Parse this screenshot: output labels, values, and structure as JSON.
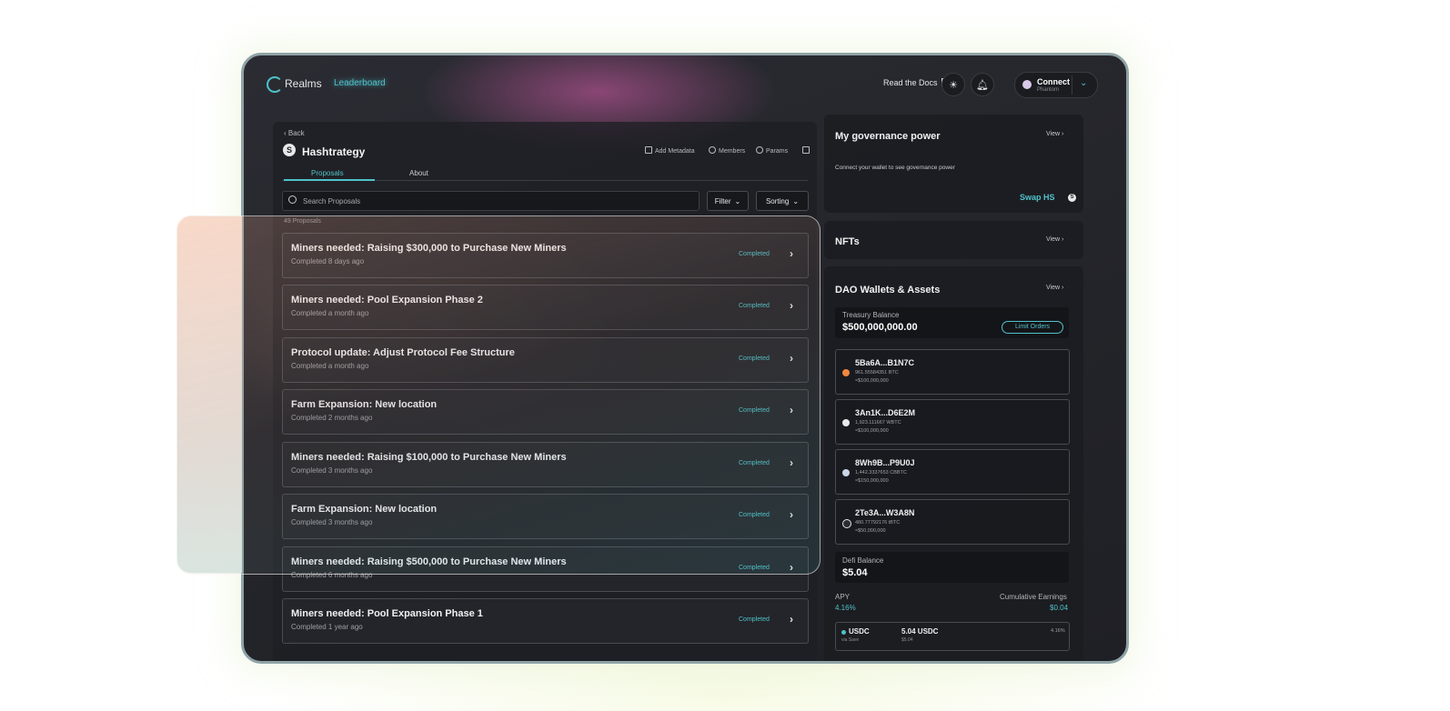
{
  "topbar": {
    "logo_text": "Realms",
    "leaderboard": "Leaderboard",
    "docs": "Read the Docs",
    "connect": {
      "title": "Connect",
      "subtitle": "Phantom"
    }
  },
  "dao": {
    "back": "Back",
    "name": "Hashtrategy",
    "logo_letter": "S",
    "links": [
      "Add Metadata",
      "Members",
      "Params"
    ],
    "tabs": [
      "Proposals",
      "About"
    ],
    "search_placeholder": "Search Proposals",
    "filter": "Filter",
    "sorting": "Sorting",
    "count": "49 Proposals"
  },
  "proposals": [
    {
      "title": "Miners needed: Raising $300,000 to Purchase New Miners",
      "sub": "Completed 8 days ago",
      "status": "Completed"
    },
    {
      "title": "Miners needed: Pool Expansion Phase 2",
      "sub": "Completed a month ago",
      "status": "Completed"
    },
    {
      "title": "Protocol update: Adjust Protocol Fee Structure",
      "sub": "Completed a month ago",
      "status": "Completed"
    },
    {
      "title": "Farm Expansion: New location",
      "sub": "Completed 2 months ago",
      "status": "Completed"
    },
    {
      "title": "Miners needed: Raising $100,000 to Purchase New Miners",
      "sub": "Completed 3 months ago",
      "status": "Completed"
    },
    {
      "title": "Farm Expansion: New location",
      "sub": "Completed 3 months ago",
      "status": "Completed"
    },
    {
      "title": "Miners needed: Raising $500,000 to Purchase New Miners",
      "sub": "Completed 6 months ago",
      "status": "Completed"
    },
    {
      "title": "Miners needed: Pool Expansion Phase 1",
      "sub": "Completed 1 year ago",
      "status": "Completed"
    }
  ],
  "governance": {
    "title": "My governance power",
    "view": "View",
    "text": "Connect your wallet to see governance power",
    "swap": "Swap HS"
  },
  "nfts": {
    "title": "NFTs",
    "view": "View"
  },
  "wallets": {
    "title": "DAO Wallets & Assets",
    "view": "View",
    "treasury_label": "Treasury Balance",
    "treasury_value": "$500,000,000.00",
    "limit_orders": "Limit Orders",
    "items": [
      {
        "addr": "5Ba6A...B1N7C",
        "bal": "961.55584351 BTC",
        "usd": "≈$100,000,000",
        "color": "#f0883e"
      },
      {
        "addr": "3An1K...D6E2M",
        "bal": "1,923.111667 WBTC",
        "usd": "≈$100,000,000",
        "color": "#e8e8ea"
      },
      {
        "addr": "8Wh9B...P9U0J",
        "bal": "1,442.3337653 CBBTC",
        "usd": "≈$150,000,000",
        "color": "#c9d6e8"
      },
      {
        "addr": "2Te3A...W3A8N",
        "bal": "480.77792176 tBTC",
        "usd": "≈$50,000,000",
        "color": "#2b2c33"
      }
    ],
    "defi_label": "Defi Balance",
    "defi_value": "$5.04",
    "apy_label": "APY",
    "apy_value": "4.16%",
    "cum_label": "Cumulative Earnings",
    "cum_value": "$0.04",
    "usdc": {
      "name": "USDC",
      "sub": "via Save",
      "amount": "5.04 USDC",
      "amount_sub": "$5.04",
      "rate": "4.16%"
    }
  },
  "colors": {
    "accent": "#4fc2c9",
    "bg": "#232429"
  }
}
